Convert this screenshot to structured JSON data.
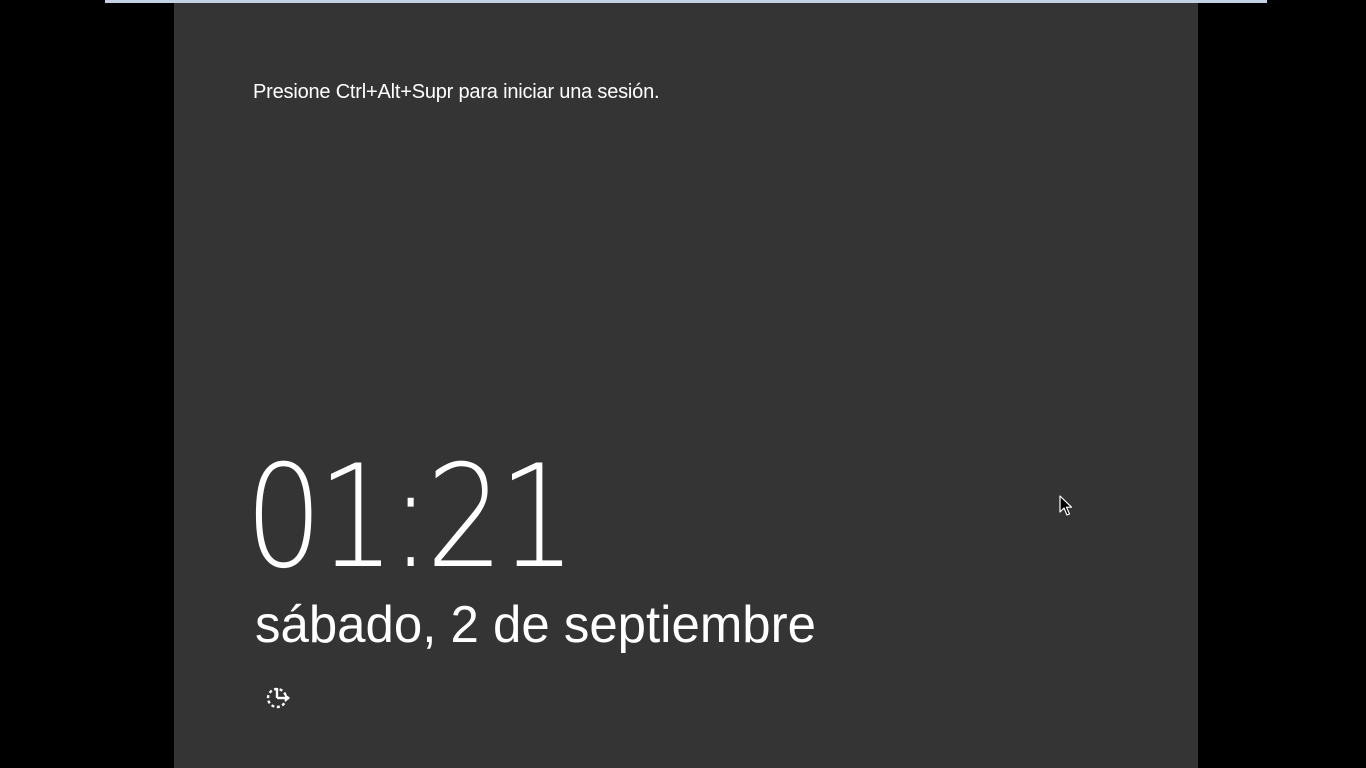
{
  "lock_screen": {
    "prompt": "Presione Ctrl+Alt+Supr para iniciar una sesión.",
    "time": "01:21",
    "date": "sábado, 2 de septiembre",
    "accessibility_icon": "ease-of-access-icon"
  },
  "colors": {
    "background": "#000000",
    "panel": "#343434",
    "top_bar": "#c5d2e6",
    "text": "#ffffff"
  }
}
